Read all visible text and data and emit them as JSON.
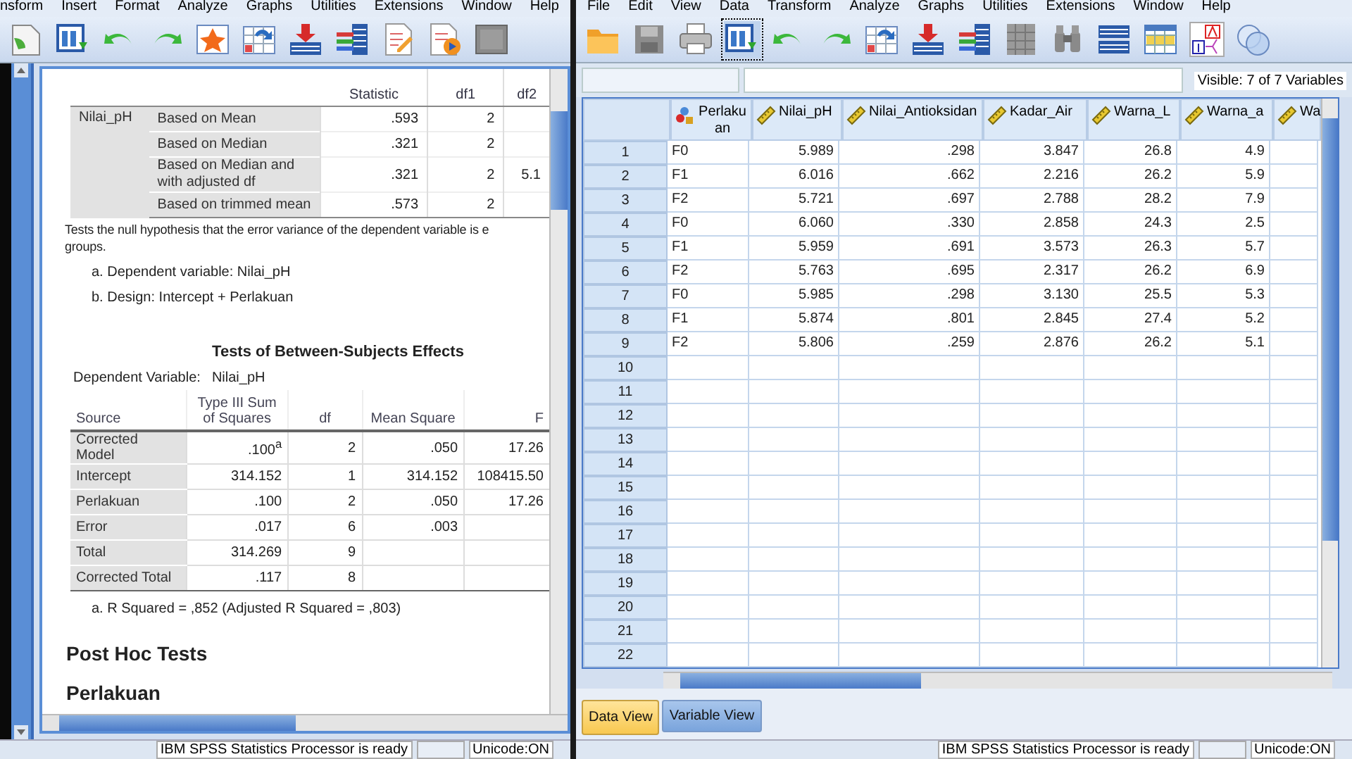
{
  "output_window": {
    "menu": [
      "nsform",
      "Insert",
      "Format",
      "Analyze",
      "Graphs",
      "Utilities",
      "Extensions",
      "Window",
      "Help"
    ],
    "levene_table": {
      "columns": [
        "Statistic",
        "df1",
        "df2"
      ],
      "variable": "Nilai_pH",
      "rows": [
        {
          "label": "Based on Mean",
          "values": [
            ".593",
            "2"
          ]
        },
        {
          "label": "Based on Median",
          "values": [
            ".321",
            "2"
          ]
        },
        {
          "label": "Based on Median and with adjusted df",
          "values": [
            ".321",
            "2",
            "5.1"
          ]
        },
        {
          "label": "Based on trimmed mean",
          "values": [
            ".573",
            "2"
          ]
        }
      ]
    },
    "note_lines": [
      "Tests the null hypothesis that the error variance of the dependent variable is e",
      "groups."
    ],
    "footnotes": [
      "a. Dependent variable: Nilai_pH",
      "b. Design: Intercept + Perlakuan"
    ],
    "effects_table": {
      "title": "Tests of Between-Subjects Effects",
      "dependent_label": "Dependent Variable:",
      "dependent_value": "Nilai_pH",
      "columns": [
        "Source",
        "Type III Sum of Squares",
        "df",
        "Mean Square",
        "F"
      ],
      "rows": [
        [
          "Corrected Model",
          ".100$^{a}$",
          "2",
          ".050",
          "17.26"
        ],
        [
          "Intercept",
          "314.152",
          "1",
          "314.152",
          "108415.50"
        ],
        [
          "Perlakuan",
          ".100",
          "2",
          ".050",
          "17.26"
        ],
        [
          "Error",
          ".017",
          "6",
          ".003"
        ],
        [
          "Total",
          "314.269",
          "9"
        ],
        [
          "Corrected Total",
          ".117",
          "8"
        ]
      ],
      "footnote": "a. R Squared = ,852 (Adjusted R Squared = ,803)"
    },
    "headings": [
      "Post Hoc Tests",
      "Perlakuan"
    ],
    "status": [
      "IBM SPSS Statistics Processor is ready",
      "Unicode:ON"
    ]
  },
  "data_window": {
    "menu": [
      "File",
      "Edit",
      "View",
      "Data",
      "Transform",
      "Analyze",
      "Graphs",
      "Utilities",
      "Extensions",
      "Window",
      "Help"
    ],
    "visible_info": "Visible: 7 of 7 Variables",
    "columns": [
      {
        "name": "Perlakuan",
        "kind": "nominal"
      },
      {
        "name": "Nilai_pH",
        "kind": "scale"
      },
      {
        "name": "Nilai_Antioksidan",
        "kind": "scale"
      },
      {
        "name": "Kadar_Air",
        "kind": "scale"
      },
      {
        "name": "Warna_L",
        "kind": "scale"
      },
      {
        "name": "Warna_a",
        "kind": "scale"
      },
      {
        "name": "Wa",
        "kind": "scale"
      }
    ],
    "rows": [
      {
        "number": "1",
        "cells": [
          "F0",
          "5.989",
          ".298",
          "3.847",
          "26.8",
          "4.9"
        ]
      },
      {
        "number": "2",
        "cells": [
          "F1",
          "6.016",
          ".662",
          "2.216",
          "26.2",
          "5.9"
        ]
      },
      {
        "number": "3",
        "cells": [
          "F2",
          "5.721",
          ".697",
          "2.788",
          "28.2",
          "7.9"
        ]
      },
      {
        "number": "4",
        "cells": [
          "F0",
          "6.060",
          ".330",
          "2.858",
          "24.3",
          "2.5"
        ]
      },
      {
        "number": "5",
        "cells": [
          "F1",
          "5.959",
          ".691",
          "3.573",
          "26.3",
          "5.7"
        ]
      },
      {
        "number": "6",
        "cells": [
          "F2",
          "5.763",
          ".695",
          "2.317",
          "26.2",
          "6.9"
        ]
      },
      {
        "number": "7",
        "cells": [
          "F0",
          "5.985",
          ".298",
          "3.130",
          "25.5",
          "5.3"
        ]
      },
      {
        "number": "8",
        "cells": [
          "F1",
          "5.874",
          ".801",
          "2.845",
          "27.4",
          "5.2"
        ]
      },
      {
        "number": "9",
        "cells": [
          "F2",
          "5.806",
          ".259",
          "2.876",
          "26.2",
          "5.1"
        ]
      },
      {
        "number": "10"
      },
      {
        "number": "11"
      },
      {
        "number": "12"
      },
      {
        "number": "13"
      },
      {
        "number": "14"
      },
      {
        "number": "15"
      },
      {
        "number": "16"
      },
      {
        "number": "17"
      },
      {
        "number": "18"
      },
      {
        "number": "19"
      },
      {
        "number": "20"
      },
      {
        "number": "21"
      },
      {
        "number": "22"
      }
    ],
    "tabs": [
      {
        "label": "Data View",
        "selected": true
      },
      {
        "label": "Variable View",
        "selected": false
      }
    ],
    "status": [
      "IBM SPSS Statistics Processor is ready",
      "Unicode:ON"
    ]
  }
}
